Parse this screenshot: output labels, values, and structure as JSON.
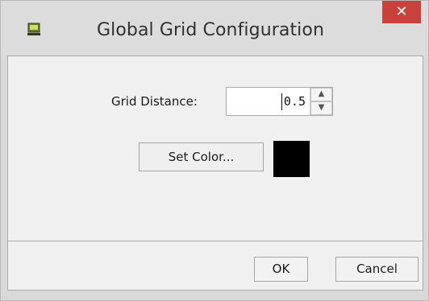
{
  "window": {
    "title": "Global Grid Configuration",
    "close_label": "✕",
    "app_icon": "grid-app-icon"
  },
  "form": {
    "grid_distance_label": "Grid Distance:",
    "grid_distance_value": "0.5",
    "set_color_label": "Set Color...",
    "selected_color": "#000000"
  },
  "footer": {
    "ok_label": "OK",
    "cancel_label": "Cancel"
  },
  "colors": {
    "titlebar_bg": "#dcdcdc",
    "close_button_bg": "#c9413a",
    "content_bg": "#f0f0f0",
    "swatch": "#000000"
  }
}
